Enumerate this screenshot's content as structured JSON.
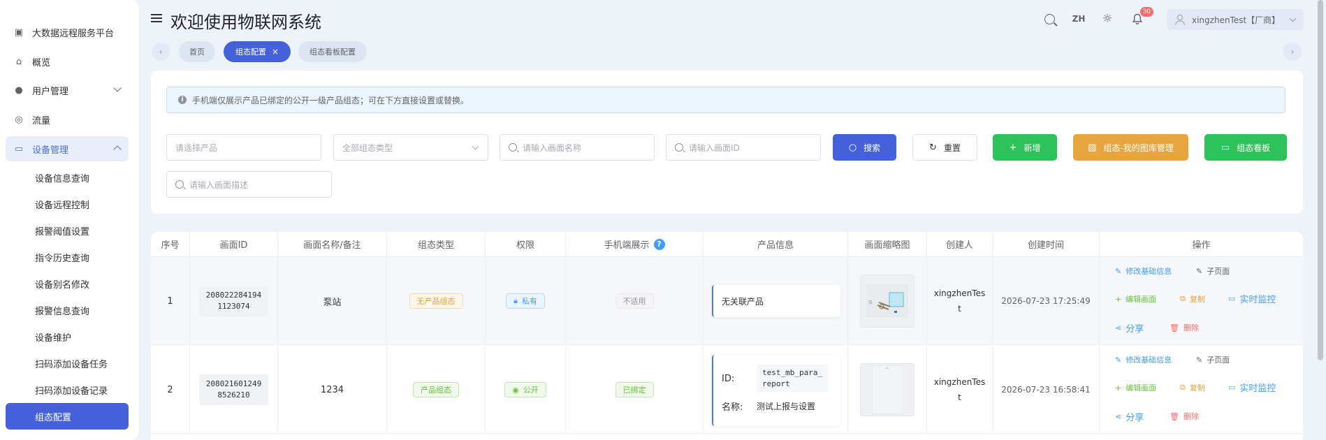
{
  "sidebar": {
    "top_items": [
      {
        "label": "大数据远程服务平台",
        "icon": "monitor-icon"
      },
      {
        "label": "概览",
        "icon": "home-icon"
      },
      {
        "label": "用户管理",
        "icon": "user-icon"
      },
      {
        "label": "流量",
        "icon": "traffic-icon"
      }
    ],
    "group": {
      "label": "设备管理",
      "icon": "device-icon"
    },
    "sub_items": [
      "设备信息查询",
      "设备远程控制",
      "报警阈值设置",
      "指令历史查询",
      "设备别名修改",
      "报警信息查询",
      "设备维护",
      "扫码添加设备任务",
      "扫码添加设备记录",
      "组态配置"
    ]
  },
  "header": {
    "title": "欢迎使用物联网系统",
    "lang": "ZH",
    "notification_count": "30",
    "user": "xingzhenTest【厂商】"
  },
  "tabs": [
    {
      "label": "首页"
    },
    {
      "label": "组态配置",
      "close": "×"
    },
    {
      "label": "组态看板配置"
    }
  ],
  "filters": {
    "alert": "手机端仅展示产品已绑定的公开一级产品组态；可在下方直接设置或替换。",
    "product_placeholder": "请选择产品",
    "type_placeholder": "全部组态类型",
    "name_placeholder": "请输入画面名称",
    "id_placeholder": "请输入画面ID",
    "desc_placeholder": "请输入画面描述",
    "search_label": "搜索",
    "reset_label": "重置",
    "add_label": "新增",
    "gallery_label": "组态-我的图库管理",
    "board_label": "组态看板"
  },
  "colors": {
    "primary": "#4461d9",
    "green": "#2fc15a",
    "orange": "#e8a53f",
    "sidebar_active": "#4461d9"
  },
  "table": {
    "headers": [
      "序号",
      "画面ID",
      "画面名称/备注",
      "组态类型",
      "权限",
      "手机端展示",
      "产品信息",
      "画面缩略图",
      "创建人",
      "创建时间",
      "操作"
    ],
    "ops": {
      "edit_info": "修改基础信息",
      "sub_page": "子页面",
      "edit_screen": "编辑画面",
      "copy": "复制",
      "monitor": "实时监控",
      "share": "分享",
      "delete": "删除"
    },
    "rows": [
      {
        "index": "1",
        "id_line1": "208022284194",
        "id_line2": "1123074",
        "name": "泵站",
        "type": "无产品组态",
        "permission": "私有",
        "mobile": "不适用",
        "product_text": "无关联产品",
        "creator_line1": "xingzhenTes",
        "creator_line2": "t",
        "created": "2026-07-23 17:25:49"
      },
      {
        "index": "2",
        "id_line1": "208021601249",
        "id_line2": "8526210",
        "name": "1234",
        "type": "产品组态",
        "permission": "公开",
        "mobile": "已绑定",
        "product_id_label": "ID:",
        "product_id_l1": "test_mb_para_",
        "product_id_l2": "report",
        "product_name_label": "名称:",
        "product_name": "测试上报与设置",
        "creator_line1": "xingzhenTes",
        "creator_line2": "t",
        "created": "2026-07-23 16:58:41"
      }
    ]
  }
}
